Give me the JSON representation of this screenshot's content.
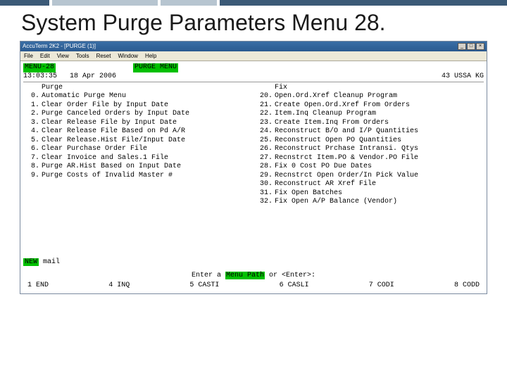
{
  "slide": {
    "title": "System Purge Parameters Menu 28."
  },
  "window": {
    "titlebar": "AccuTerm 2K2 - [PURGE (1)]",
    "menu": [
      "File",
      "Edit",
      "View",
      "Tools",
      "Reset",
      "Window",
      "Help"
    ]
  },
  "term": {
    "menu_label": "MENU-28",
    "menu_title": "PURGE MENU",
    "time": "13:03:35",
    "date": "18 Apr 2006",
    "station": "43 USSA KG",
    "left_header": "Purge",
    "right_header": "Fix",
    "left": [
      {
        "n": "0.",
        "t": "Automatic Purge Menu"
      },
      {
        "n": "1.",
        "t": "Clear Order File by Input Date"
      },
      {
        "n": "2.",
        "t": "Purge Canceled Orders by Input Date"
      },
      {
        "n": "3.",
        "t": "Clear Release File by Input Date"
      },
      {
        "n": "4.",
        "t": "Clear Release File Based on Pd A/R"
      },
      {
        "n": "5.",
        "t": "Clear Release.Hist File/Input Date"
      },
      {
        "n": "6.",
        "t": "Clear Purchase Order File"
      },
      {
        "n": "7.",
        "t": "Clear Invoice and Sales.1 File"
      },
      {
        "n": "8.",
        "t": "Purge AR.Hist Based on Input Date"
      },
      {
        "n": "9.",
        "t": "Purge Costs of Invalid Master #"
      }
    ],
    "right": [
      {
        "n": "20.",
        "t": "Open.Ord.Xref Cleanup Program"
      },
      {
        "n": "21.",
        "t": "Create Open.Ord.Xref From Orders"
      },
      {
        "n": "22.",
        "t": "Item.Inq Cleanup Program"
      },
      {
        "n": "23.",
        "t": "Create Item.Inq From Orders"
      },
      {
        "n": "24.",
        "t": "Reconstruct B/O and I/P Quantities"
      },
      {
        "n": "25.",
        "t": "Reconstruct Open PO Quantities"
      },
      {
        "n": "26.",
        "t": "Reconstruct Prchase Intransi. Qtys"
      },
      {
        "n": "27.",
        "t": "Recnstrct Item.PO & Vendor.PO File"
      },
      {
        "n": "28.",
        "t": "Fix 0 Cost PO Due Dates"
      },
      {
        "n": "29.",
        "t": "Recnstrct Open Order/In Pick Value"
      },
      {
        "n": "30.",
        "t": "Reconstruct AR Xref File"
      },
      {
        "n": "31.",
        "t": "Fix Open Batches"
      },
      {
        "n": "32.",
        "t": "Fix Open A/P Balance (Vendor)"
      }
    ],
    "new_mail_left": "NEW",
    "new_mail_right": " mail",
    "prompt_pre": "Enter a ",
    "prompt_hl": "Menu Path",
    "prompt_post": " or <Enter>:",
    "fkeys": [
      "1  END",
      "4  INQ",
      "5  CASTI",
      "6  CASLI",
      "7  CODI",
      "8  CODD"
    ]
  }
}
